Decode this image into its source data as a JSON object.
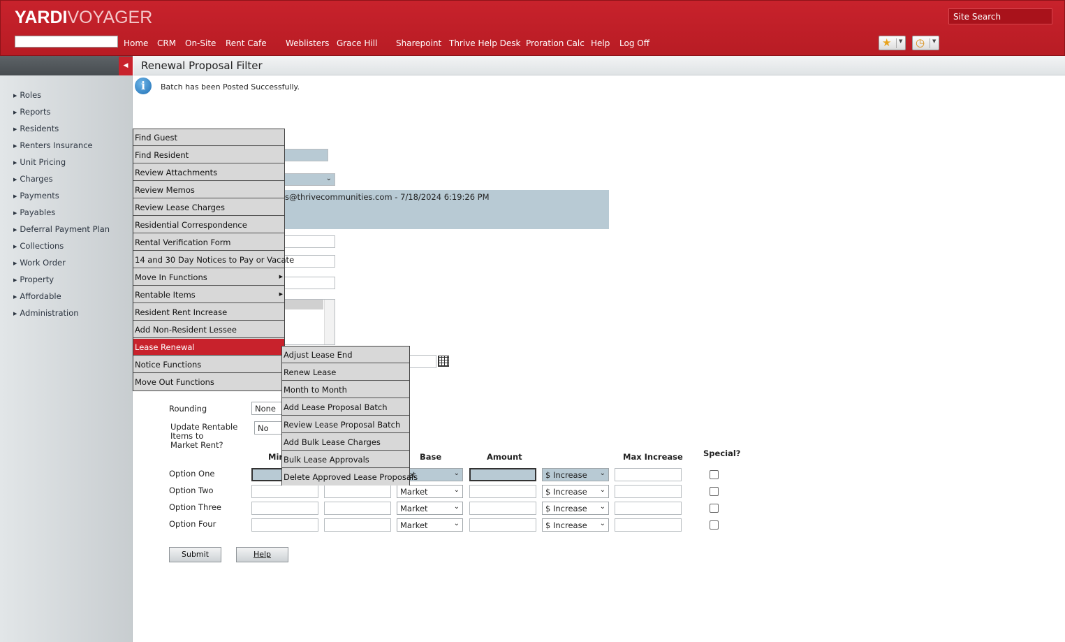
{
  "header": {
    "logo_brand": "YARDI",
    "logo_product": "VOYAGER",
    "site_search": "Site Search",
    "nav": [
      "Home",
      "CRM",
      "On-Site",
      "Rent Cafe",
      "Weblisters",
      "Grace Hill",
      "Sharepoint",
      "Thrive Help Desk",
      "Proration Calc",
      "Help",
      "Log Off"
    ]
  },
  "sidebar": {
    "items": [
      "Roles",
      "Reports",
      "Residents",
      "Renters Insurance",
      "Unit Pricing",
      "Charges",
      "Payments",
      "Payables",
      "Deferral Payment Plan",
      "Collections",
      "Work Order",
      "Property",
      "Affordable",
      "Administration"
    ]
  },
  "page": {
    "title": "Renewal Proposal Filter",
    "info_message": "Batch has been Posted Successfully.",
    "posted_text": "s@thrivecommunities.com - 7/18/2024 6:19:26 PM"
  },
  "form": {
    "rounding_label": "Rounding",
    "rounding_value": "None",
    "update_rentable_label": [
      "Update Rentable",
      "Items to",
      "Market Rent?"
    ],
    "update_rentable_value": "No",
    "columns": {
      "min": "Mir",
      "base": "Base",
      "amount": "Amount",
      "max_increase": "Max Increase",
      "special": "Special?"
    },
    "options": [
      {
        "label": "Option One",
        "base": "rket",
        "type": "$ Increase"
      },
      {
        "label": "Option Two",
        "base": "Market",
        "type": "$ Increase"
      },
      {
        "label": "Option Three",
        "base": "Market",
        "type": "$ Increase"
      },
      {
        "label": "Option Four",
        "base": "Market",
        "type": "$ Increase"
      }
    ],
    "submit_label": "Submit",
    "help_label": "Help"
  },
  "context_menu": {
    "items": [
      "Find Guest",
      "Find Resident",
      "Review Attachments",
      "Review Memos",
      "Review Lease Charges",
      "Residential Correspondence",
      "Rental Verification Form",
      "14 and 30 Day Notices to Pay or Vacate",
      "Move In Functions",
      "Rentable Items",
      "Resident Rent Increase",
      "Add Non-Resident Lessee",
      "Lease Renewal",
      "Notice Functions",
      "Move Out Functions"
    ],
    "active_item": "Lease Renewal"
  },
  "submenu": {
    "items": [
      "Adjust Lease End",
      "Renew Lease",
      "Month to Month",
      "Add Lease Proposal Batch",
      "Review Lease Proposal Batch",
      "Add Bulk Lease Charges",
      "Bulk Lease Approvals",
      "Delete Approved Lease Proposals"
    ]
  },
  "colors": {
    "brand_red": "#c8222c",
    "active_menu": "#c8222c",
    "field_highlight": "#b8cad4"
  }
}
